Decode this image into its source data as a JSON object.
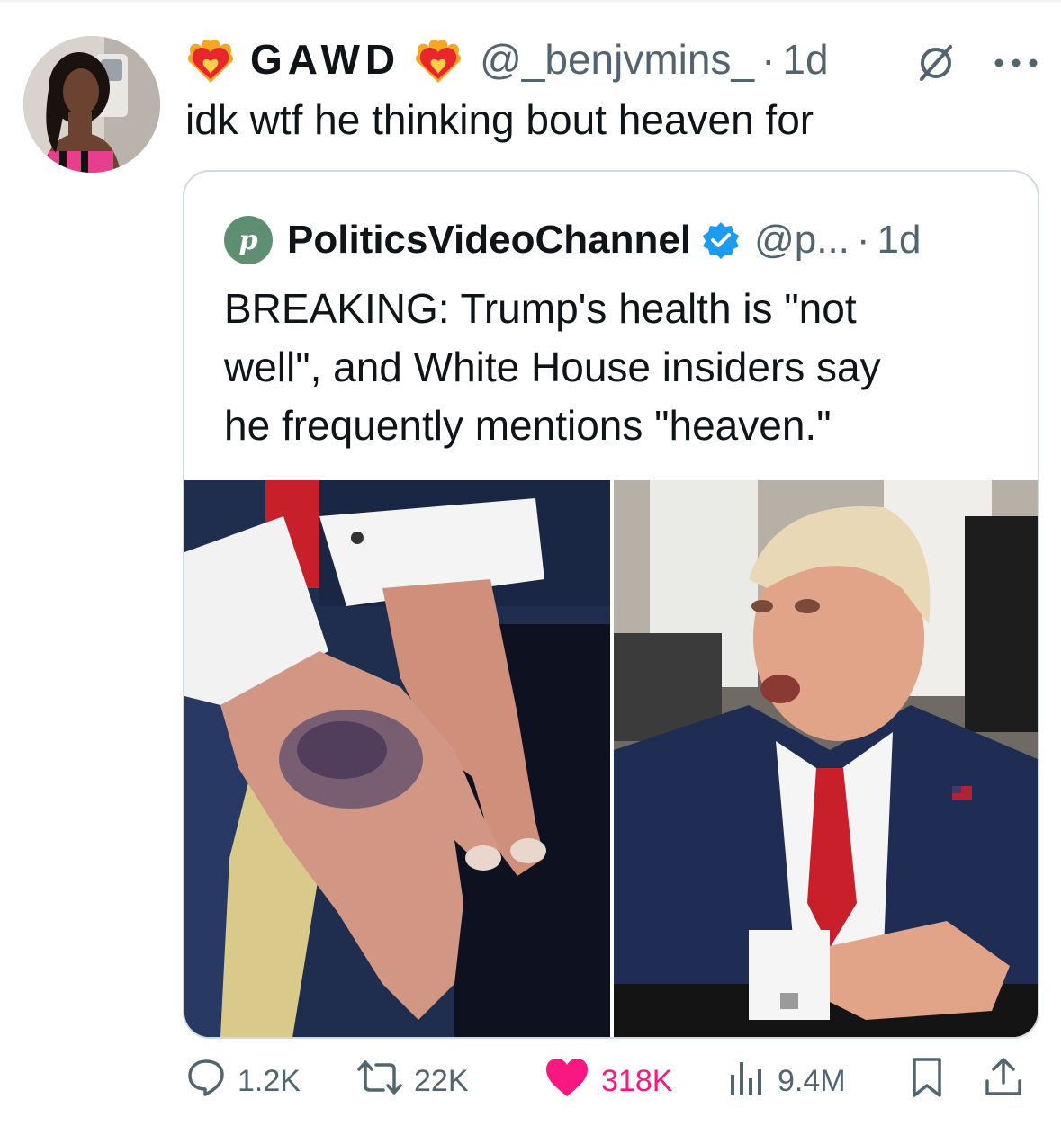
{
  "tweet": {
    "author": {
      "display_name": "GAWD",
      "handle": "@_benjvmins_",
      "name_emoji_left": "heart-on-fire-icon",
      "name_emoji_right": "heart-on-fire-icon"
    },
    "separator": "·",
    "time": "1d",
    "text": "idk wtf he thinking bout heaven for"
  },
  "quote": {
    "avatar_letter": "p",
    "avatar_color": "#5e8f73",
    "name": "PoliticsVideoChannel",
    "handle": "@p...",
    "separator": "·",
    "time": "1d",
    "text_lines": [
      "BREAKING: Trump's health is \"not",
      "well\", and White House insiders say",
      "he frequently mentions \"heaven.\""
    ]
  },
  "actions": {
    "replies": "1.2K",
    "reposts": "22K",
    "likes": "318K",
    "views": "9.4M"
  },
  "colors": {
    "text": "#0f1419",
    "muted": "#536471",
    "like": "#f91880",
    "verified": "#1d9bf0",
    "border": "#cfd9de"
  }
}
